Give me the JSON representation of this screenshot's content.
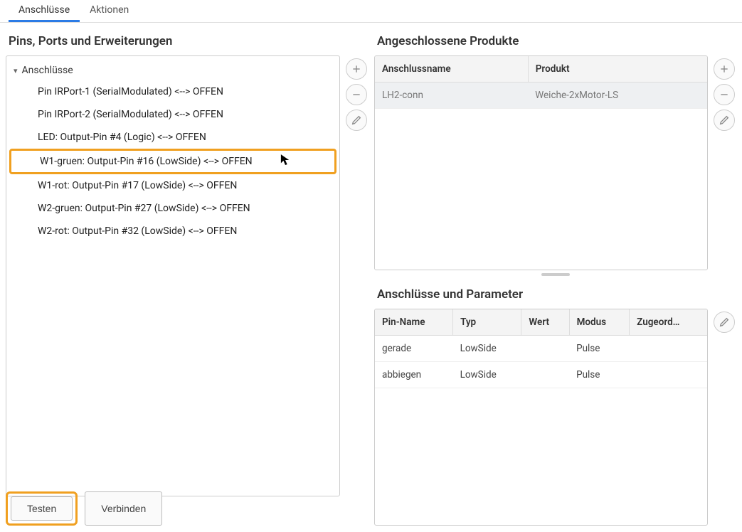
{
  "tabs": {
    "connections": "Anschlüsse",
    "actions": "Aktionen"
  },
  "left": {
    "title": "Pins, Ports und Erweiterungen",
    "root": "Anschlüsse",
    "items": [
      "Pin IRPort-1 (SerialModulated) <--> OFFEN",
      "Pin IRPort-2 (SerialModulated) <--> OFFEN",
      "LED: Output-Pin #4 (Logic) <--> OFFEN",
      "W1-gruen: Output-Pin #16 (LowSide) <--> OFFEN",
      "W1-rot: Output-Pin #17 (LowSide) <--> OFFEN",
      "W2-gruen: Output-Pin #27 (LowSide) <--> OFFEN",
      "W2-rot: Output-Pin #32 (LowSide) <--> OFFEN"
    ],
    "buttons": {
      "test": "Testen",
      "connect": "Verbinden"
    }
  },
  "rightTop": {
    "title": "Angeschlossene Produkte",
    "headers": {
      "name": "Anschlussname",
      "product": "Produkt"
    },
    "row0": {
      "name": "LH2-conn",
      "product": "Weiche-2xMotor-LS"
    }
  },
  "rightBottom": {
    "title": "Anschlüsse und Parameter",
    "headers": {
      "pin": "Pin-Name",
      "type": "Typ",
      "value": "Wert",
      "mode": "Modus",
      "assigned": "Zugeord…"
    },
    "row0": {
      "pin": "gerade",
      "type": "LowSide",
      "value": "",
      "mode": "Pulse",
      "assigned": ""
    },
    "row1": {
      "pin": "abbiegen",
      "type": "LowSide",
      "value": "",
      "mode": "Pulse",
      "assigned": ""
    }
  }
}
